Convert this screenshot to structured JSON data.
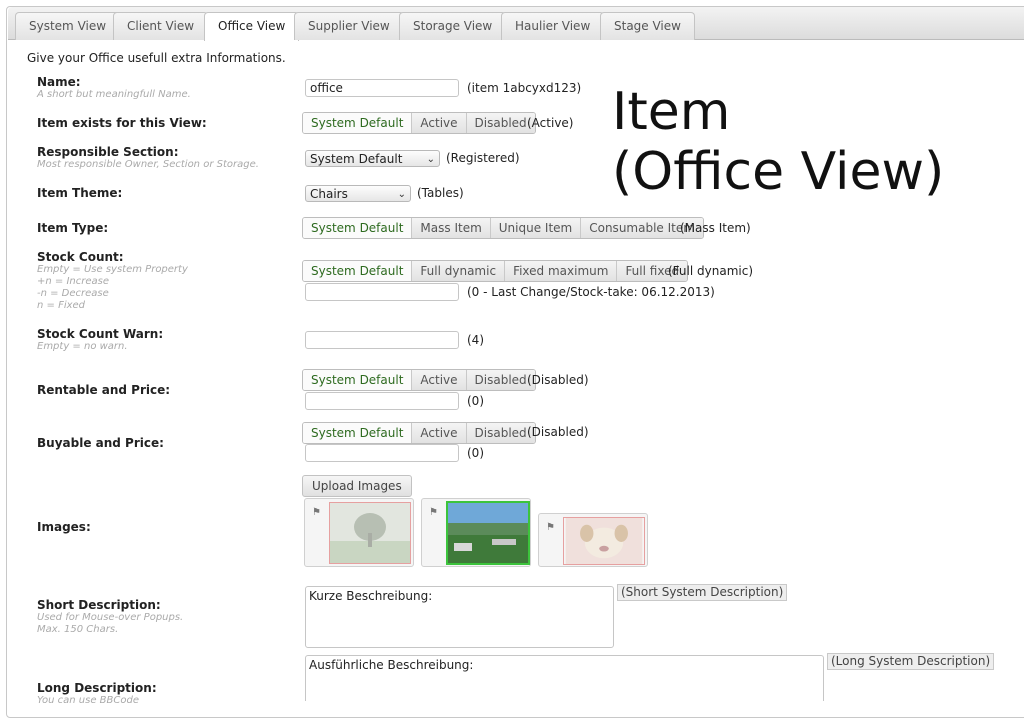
{
  "tabs": [
    "System View",
    "Client View",
    "Office View",
    "Supplier View",
    "Storage View",
    "Haulier View",
    "Stage View"
  ],
  "intro": "Give your Office usefull extra Informations.",
  "overlay": {
    "line1": "Item",
    "line2": "(Office View)"
  },
  "fields": {
    "name": {
      "label": "Name:",
      "hint": "A short but meaningfull Name.",
      "value": "office",
      "note": "(item 1abcyxd123)"
    },
    "exists": {
      "label": "Item exists for this View:",
      "options": [
        "System Default",
        "Active",
        "Disabled"
      ],
      "note": "(Active)"
    },
    "section": {
      "label": "Responsible Section:",
      "hint": "Most responsible Owner, Section or Storage.",
      "value": "System Default",
      "note": "(Registered)"
    },
    "theme": {
      "label": "Item Theme:",
      "value": "Chairs",
      "note": "(Tables)"
    },
    "type": {
      "label": "Item Type:",
      "options": [
        "System Default",
        "Mass Item",
        "Unique Item",
        "Consumable Item"
      ],
      "note": "(Mass Item)"
    },
    "stock": {
      "label": "Stock Count:",
      "hints": [
        "Empty = Use system Property",
        "+n = Increase",
        "-n = Decrease",
        "n = Fixed"
      ],
      "options": [
        "System Default",
        "Full dynamic",
        "Fixed maximum",
        "Full fixed"
      ],
      "note": "(Full dynamic)",
      "input_note": "(0 - Last Change/Stock-take: 06.12.2013)"
    },
    "warn": {
      "label": "Stock Count Warn:",
      "hint": "Empty = no warn.",
      "note": "(4)"
    },
    "rentable": {
      "label": "Rentable and Price:",
      "options": [
        "System Default",
        "Active",
        "Disabled"
      ],
      "note": "(Disabled)",
      "input_note": "(0)"
    },
    "buyable": {
      "label": "Buyable and Price:",
      "options": [
        "System Default",
        "Active",
        "Disabled"
      ],
      "note": "(Disabled)",
      "input_note": "(0)"
    },
    "images": {
      "label": "Images:",
      "upload": "Upload Images"
    },
    "short_desc": {
      "label": "Short Description:",
      "hints": [
        "Used for Mouse-over Popups.",
        "Max. 150 Chars."
      ],
      "value": "Kurze Beschreibung:",
      "tag": "(Short System Description)"
    },
    "long_desc": {
      "label": "Long Description:",
      "hint": "You can use BBCode",
      "value": "Ausführliche Beschreibung:",
      "tag": "(Long System Description)"
    }
  },
  "colors": {
    "selected_text": "#2d6a1f",
    "selected_image_border": "#3cc43c",
    "image_border": "#e6a0a0"
  }
}
